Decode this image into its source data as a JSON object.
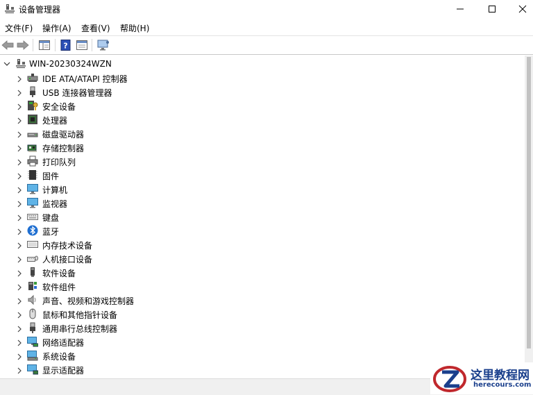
{
  "window": {
    "title": "设备管理器"
  },
  "menu": [
    "文件(F)",
    "操作(A)",
    "查看(V)",
    "帮助(H)"
  ],
  "tree": {
    "root": "WIN-20230324WZN",
    "items": [
      {
        "label": "IDE ATA/ATAPI 控制器",
        "icon": "ide-controller-icon"
      },
      {
        "label": "USB 连接器管理器",
        "icon": "usb-connector-icon"
      },
      {
        "label": "安全设备",
        "icon": "security-device-icon"
      },
      {
        "label": "处理器",
        "icon": "processor-icon"
      },
      {
        "label": "磁盘驱动器",
        "icon": "disk-drive-icon"
      },
      {
        "label": "存储控制器",
        "icon": "storage-controller-icon"
      },
      {
        "label": "打印队列",
        "icon": "printer-icon"
      },
      {
        "label": "固件",
        "icon": "firmware-icon"
      },
      {
        "label": "计算机",
        "icon": "computer-icon"
      },
      {
        "label": "监视器",
        "icon": "monitor-icon"
      },
      {
        "label": "键盘",
        "icon": "keyboard-icon"
      },
      {
        "label": "蓝牙",
        "icon": "bluetooth-icon"
      },
      {
        "label": "内存技术设备",
        "icon": "memory-device-icon"
      },
      {
        "label": "人机接口设备",
        "icon": "hid-icon"
      },
      {
        "label": "软件设备",
        "icon": "software-device-icon"
      },
      {
        "label": "软件组件",
        "icon": "software-component-icon"
      },
      {
        "label": "声音、视频和游戏控制器",
        "icon": "sound-icon"
      },
      {
        "label": "鼠标和其他指针设备",
        "icon": "mouse-icon"
      },
      {
        "label": "通用串行总线控制器",
        "icon": "usb-controller-icon"
      },
      {
        "label": "网络适配器",
        "icon": "network-adapter-icon"
      },
      {
        "label": "系统设备",
        "icon": "system-device-icon"
      },
      {
        "label": "显示适配器",
        "icon": "display-adapter-icon"
      }
    ]
  },
  "watermark": {
    "cn": "这里教程网",
    "en": "herecours.com"
  }
}
